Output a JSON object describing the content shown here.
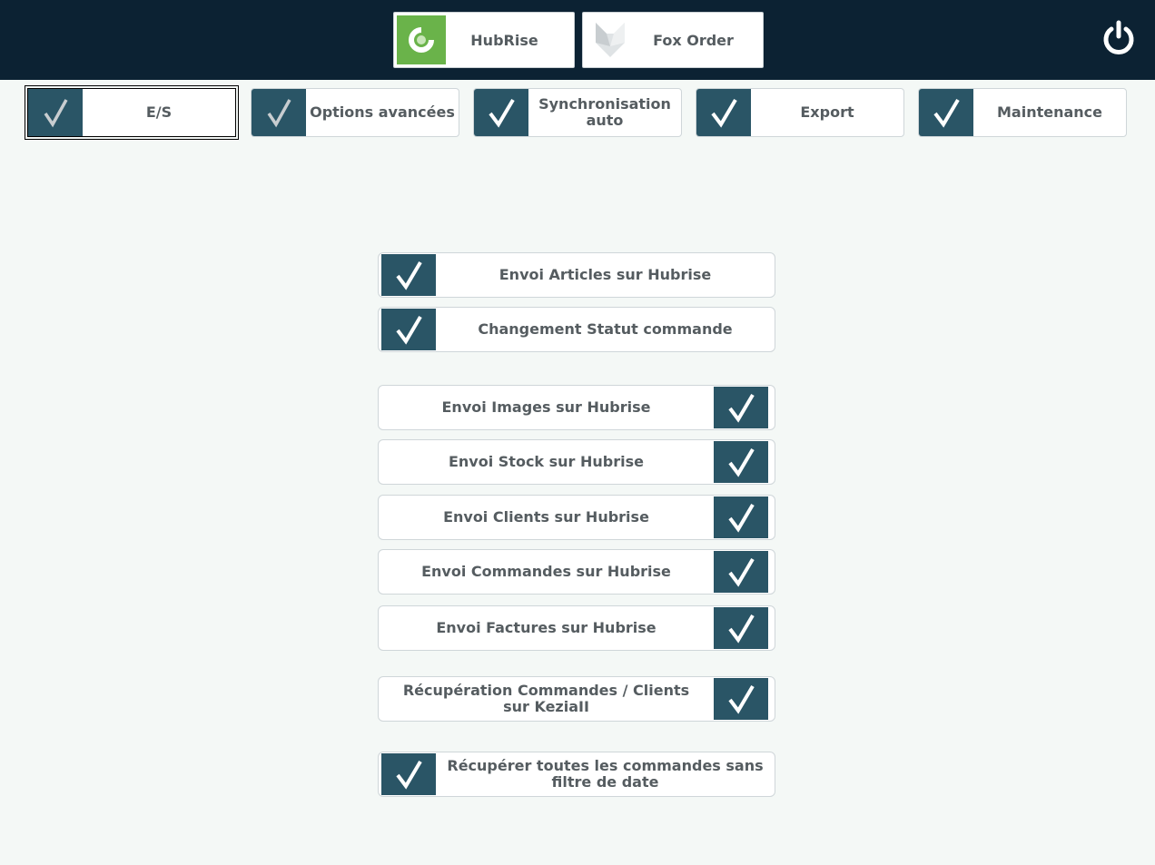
{
  "header": {
    "apps": [
      {
        "label": "HubRise",
        "icon": "hubrise-logo-icon"
      },
      {
        "label": "Fox Order",
        "icon": "fox-logo-icon"
      }
    ],
    "power_icon": "power-icon"
  },
  "tabs": [
    {
      "label": "E/S",
      "active": true
    },
    {
      "label": "Options avancées",
      "active": false
    },
    {
      "label": "Synchronisation auto",
      "active": false
    },
    {
      "label": "Export",
      "active": false
    },
    {
      "label": "Maintenance",
      "active": false
    }
  ],
  "options": [
    {
      "label": "Envoi Articles sur Hubrise",
      "checked": true
    },
    {
      "label": "Changement Statut commande",
      "checked": true
    },
    {
      "label": "Envoi Images sur Hubrise",
      "checked": true
    },
    {
      "label": "Envoi Stock sur Hubrise",
      "checked": true
    },
    {
      "label": "Envoi Clients sur Hubrise",
      "checked": true
    },
    {
      "label": "Envoi Commandes sur Hubrise",
      "checked": true
    },
    {
      "label": "Envoi Factures sur Hubrise",
      "checked": true
    },
    {
      "label": "Récupération Commandes / Clients sur KeziaII",
      "checked": true
    },
    {
      "label": "Récupérer toutes les commandes sans filtre de date",
      "checked": true
    }
  ],
  "colors": {
    "topbar": "#0c2233",
    "check_bg": "#2a5566",
    "hubrise_green": "#6ab34a",
    "background": "#f4f8f6"
  }
}
